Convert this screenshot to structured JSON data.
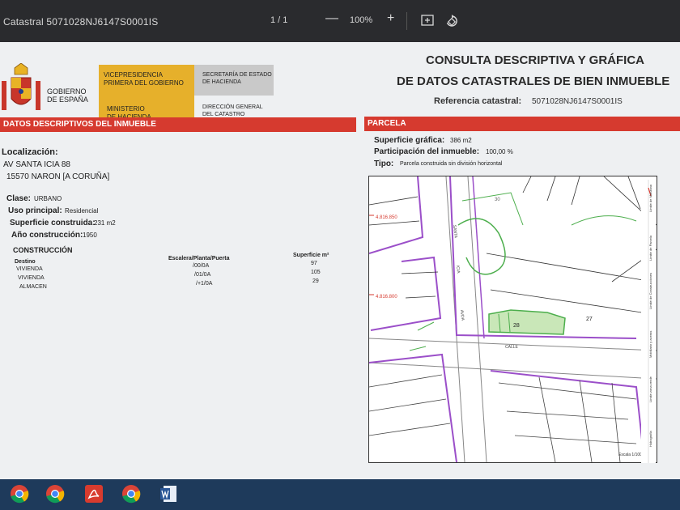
{
  "toolbar": {
    "title": "Catastral 5071028NJ6147S0001IS",
    "page": "1 / 1",
    "zoom_out": "—",
    "zoom": "100%",
    "zoom_in": "+"
  },
  "logo": {
    "gobierno": "GOBIERNO",
    "espana": "DE ESPAÑA",
    "vice_1": "VICEPRESIDENCIA",
    "vice_2": "PRIMERA DEL GOBIERNO",
    "ministerio_1": "MINISTERIO",
    "ministerio_2": "DE HACIENDA",
    "secretaria_1": "SECRETARÍA DE ESTADO",
    "secretaria_2": "DE HACIENDA",
    "direccion_1": "DIRECCIÓN GENERAL",
    "direccion_2": "DEL CATASTRO"
  },
  "header": {
    "line1": "CONSULTA DESCRIPTIVA Y GRÁFICA",
    "line2": "DE DATOS CATASTRALES DE BIEN INMUEBLE",
    "ref_label": "Referencia catastral:",
    "ref_value": "5071028NJ6147S0001IS"
  },
  "descriptivos": {
    "heading": "DATOS DESCRIPTIVOS DEL INMUEBLE",
    "loc_label": "Localización:",
    "addr1": "AV SANTA ICIA 88",
    "addr2": "15570 NARON [A CORUÑA]",
    "clase_label": "Clase:",
    "clase_value": "URBANO",
    "uso_label": "Uso principal:",
    "uso_value": "Residencial",
    "sup_label": "Superficie construida:",
    "sup_value": "231 m2",
    "anio_label": "Año construcción:",
    "anio_value": "1950"
  },
  "construccion": {
    "heading": "CONSTRUCCIÓN",
    "col_destino": "Destino",
    "col_escalera": "Escalera/Planta/Puerta",
    "col_superficie": "Superficie m²",
    "rows": [
      {
        "destino": "VIVIENDA",
        "ubic": "/00/0A",
        "sup": "97"
      },
      {
        "destino": "VIVIENDA",
        "ubic": "/01/0A",
        "sup": "105"
      },
      {
        "destino": "ALMACEN",
        "ubic": "/+1/0A",
        "sup": "29"
      }
    ]
  },
  "parcela": {
    "heading": "PARCELA",
    "graf_label": "Superficie gráfica:",
    "graf_value": "386 m2",
    "part_label": "Participación del inmueble:",
    "part_value": "100,00 %",
    "tipo_label": "Tipo:",
    "tipo_value": "Parcela construida sin división horizontal"
  },
  "map": {
    "coord_1": "4.816.850",
    "coord_2": "4.816.800",
    "street_1": "SANTA",
    "street_2": "ICIA",
    "street_3": "AVDA",
    "street_4": "CALLE",
    "parcel_main": "28",
    "parcel_2": "27",
    "parcel_3": "30",
    "scale": "Escala 1/1000"
  },
  "legend": {
    "lines": [
      "Límite de Manzana",
      "Límite de Parcela",
      "Límite de Construcciones",
      "Mobiliario y aceras",
      "Límite zona verde",
      "Hidrografía"
    ]
  },
  "taskbar": {
    "icons": [
      "chrome-icon",
      "chrome-icon",
      "acrobat-icon",
      "chrome-icon",
      "word-icon"
    ]
  }
}
